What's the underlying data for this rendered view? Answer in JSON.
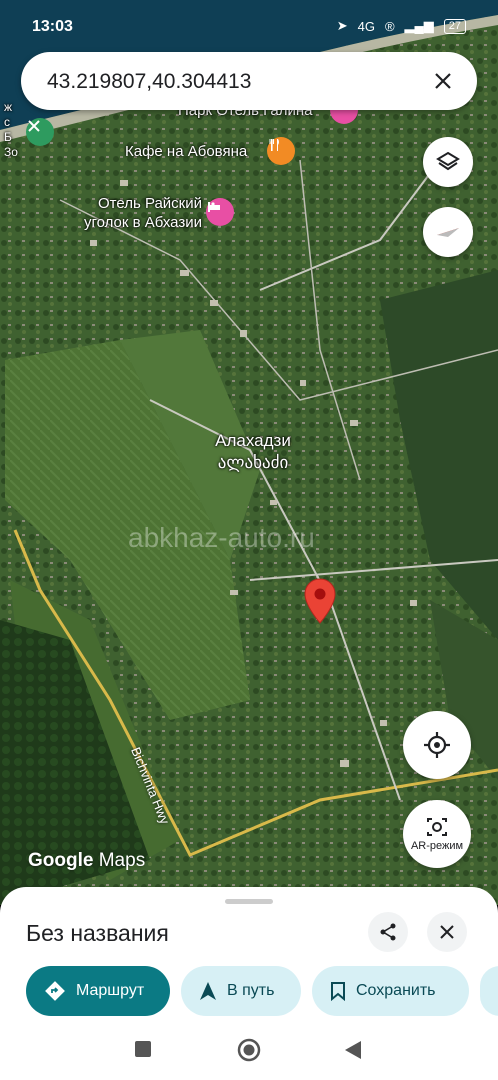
{
  "status_bar": {
    "time": "13:03",
    "network": "4G",
    "battery": "27"
  },
  "search": {
    "query": "43.219807,40.304413"
  },
  "map": {
    "pois": [
      {
        "name": "Парк Отель Галина"
      },
      {
        "name": "Кафе на Абовяна"
      },
      {
        "name": "Отель Райский уголок в Абхазии"
      }
    ],
    "place_name_ru": "Алахадзи",
    "place_name_ka": "ალახაძი",
    "road_label": "Bichvinta Hwy",
    "watermark": "abkhaz-auto.ru",
    "logo_google": "Google",
    "logo_maps": "Maps",
    "ar_label": "AR-режим",
    "left_edge_text": "ж\nс\nБ\nЗо"
  },
  "sheet": {
    "title": "Без названия",
    "buttons": [
      {
        "label": "Маршрут",
        "icon": "directions-icon"
      },
      {
        "label": "В путь",
        "icon": "navigation-arrow-icon"
      },
      {
        "label": "Сохранить",
        "icon": "bookmark-icon"
      }
    ]
  },
  "colors": {
    "accent": "#0b7a84",
    "pin": "#ea4335",
    "chip_light": "#d7f0f5",
    "poi_food": "#f28b24",
    "poi_hotel": "#e84fa4"
  }
}
